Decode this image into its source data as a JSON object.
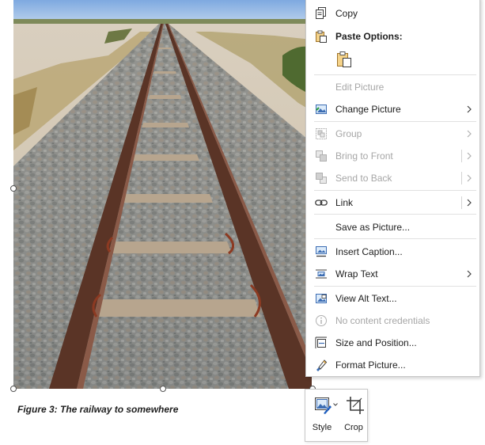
{
  "caption": "Figure 3: The railway to somewhere",
  "menu": {
    "copy": "Copy",
    "paste_options": "Paste Options:",
    "edit_picture": "Edit Picture",
    "change_picture": "Change Picture",
    "group": "Group",
    "bring_to_front": "Bring to Front",
    "send_to_back": "Send to Back",
    "link": "Link",
    "save_as_picture": "Save as Picture...",
    "insert_caption": "Insert Caption...",
    "wrap_text": "Wrap Text",
    "view_alt_text": "View Alt Text...",
    "no_content_credentials": "No content credentials",
    "size_and_position": "Size and Position...",
    "format_picture": "Format Picture..."
  },
  "mini_toolbar": {
    "style": "Style",
    "crop": "Crop"
  },
  "colors": {
    "accent_blue": "#1f5fbf",
    "disabled_text": "#a6a6a6",
    "rail": "#5a3426"
  },
  "icons": {
    "copy": "copy-icon",
    "paste": "paste-clipboard-icon",
    "change_picture": "change-picture-icon",
    "group": "group-icon",
    "bring_to_front": "bring-to-front-icon",
    "send_to_back": "send-to-back-icon",
    "link": "link-icon",
    "insert_caption": "insert-caption-icon",
    "wrap_text": "wrap-text-icon",
    "view_alt_text": "alt-text-icon",
    "content_credentials": "info-icon",
    "size_position": "size-position-icon",
    "format_picture": "format-picture-icon",
    "style": "picture-style-icon",
    "crop": "crop-icon"
  }
}
